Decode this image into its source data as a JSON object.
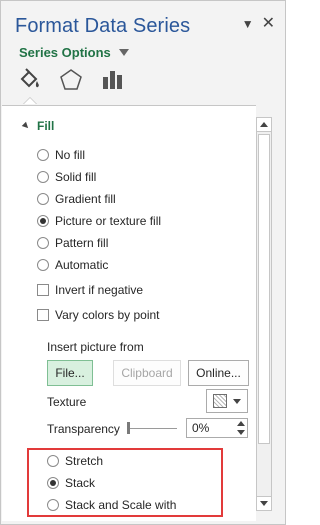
{
  "pane": {
    "title": "Format Data Series",
    "series_options_label": "Series Options",
    "tabs": [
      {
        "name": "fill-line-icon",
        "active": true
      },
      {
        "name": "effects-icon",
        "active": false
      },
      {
        "name": "series-options-icon",
        "active": false
      }
    ]
  },
  "fill": {
    "header": "Fill",
    "options": [
      {
        "label": "No fill",
        "selected": false
      },
      {
        "label": "Solid fill",
        "selected": false
      },
      {
        "label": "Gradient fill",
        "selected": false
      },
      {
        "label": "Picture or texture fill",
        "selected": true
      },
      {
        "label": "Pattern fill",
        "selected": false
      },
      {
        "label": "Automatic",
        "selected": false
      }
    ],
    "invert_if_negative": "Invert if negative",
    "vary_colors": "Vary colors by point",
    "insert_picture_from": "Insert picture from",
    "buttons": {
      "file": "File...",
      "clipboard": "Clipboard",
      "online": "Online..."
    },
    "texture_label": "Texture",
    "transparency_label": "Transparency",
    "transparency_value": "0%",
    "stretch_options": [
      {
        "label": "Stretch",
        "selected": false
      },
      {
        "label": "Stack",
        "selected": true
      },
      {
        "label": "Stack and Scale with",
        "selected": false
      }
    ]
  },
  "colors": {
    "accent_title": "#2b579a",
    "section_green": "#217346",
    "highlight_red": "#e23a3a"
  }
}
